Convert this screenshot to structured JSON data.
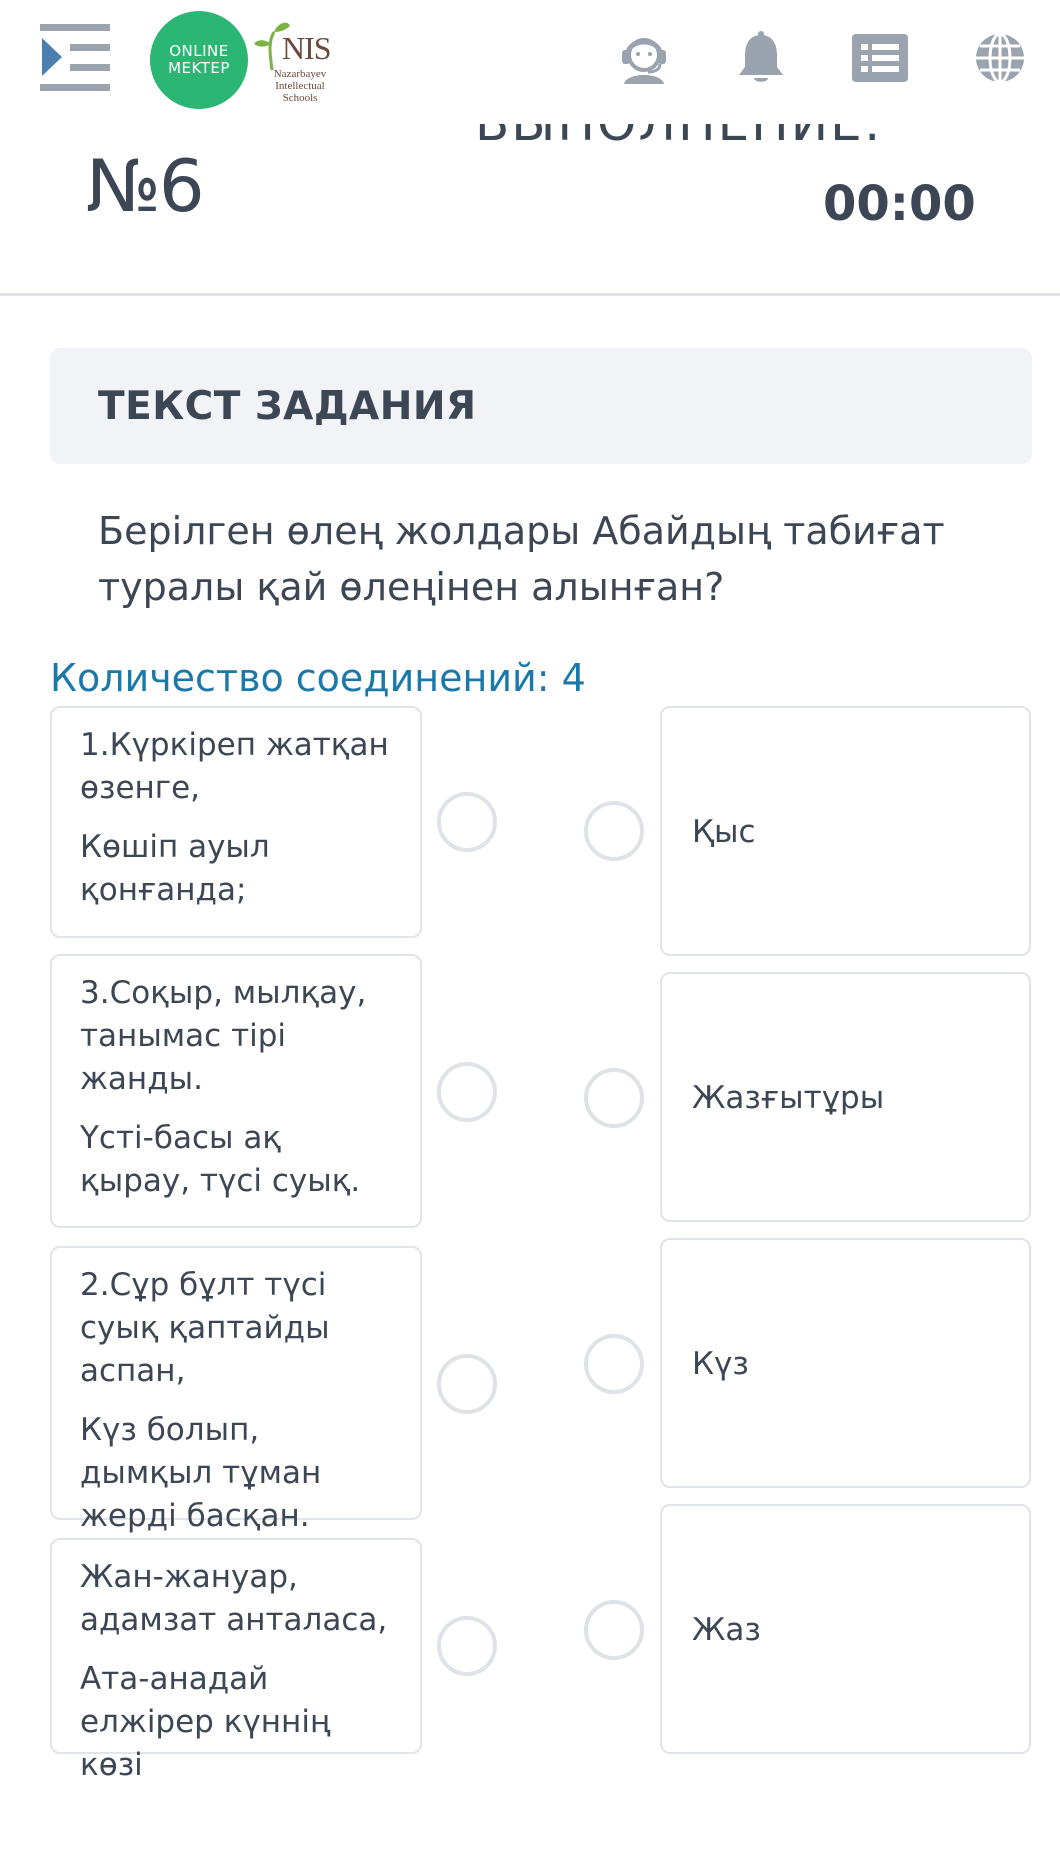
{
  "header": {
    "logo_line1": "ONLINE",
    "logo_line2": "MEKTEP",
    "nis_title": "NIS",
    "nis_sub1": "Nazarbayev",
    "nis_sub2": "Intellectual",
    "nis_sub3": "Schools",
    "icons": [
      "menu-icon",
      "support-agent-icon",
      "bell-icon",
      "list-icon",
      "globe-icon"
    ],
    "colors": {
      "logo_green": "#2bb673",
      "icon_gray": "#9aa3ae",
      "nis_brown": "#6b4a3a"
    }
  },
  "task": {
    "number": "№6",
    "exec_label_fragment": "ВЫПОЛНЕНИЕ:",
    "timer": "00:00"
  },
  "section": {
    "title": "ТЕКСТ ЗАДАНИЯ"
  },
  "question": {
    "text": "Берілген өлең жолдары Абайдың табиғат туралы қай өлеңінен алынған?"
  },
  "connections": {
    "label": "Количество соединений: 4",
    "accent_color": "#1a79a8"
  },
  "left_items": [
    {
      "line1": "1.Күркіреп жатқан өзенге,",
      "line2": "Көшіп ауыл қонғанда;"
    },
    {
      "line1": "3.Соқыр, мылқау, танымас тірі жанды.",
      "line2": "Үсті-басы ақ қырау, түсі суық."
    },
    {
      "line1": "2.Сұр бұлт түсі суық қаптайды аспан,",
      "line2": "Күз болып, дымқыл тұман жерді басқан."
    },
    {
      "line1": "Жан-жануар, адамзат анталаса,",
      "line2": "Ата-анадай елжірер күннің көзі"
    }
  ],
  "right_items": [
    {
      "label": "Қыс"
    },
    {
      "label": "Жазғытұры"
    },
    {
      "label": "Күз"
    },
    {
      "label": "Жаз"
    }
  ]
}
